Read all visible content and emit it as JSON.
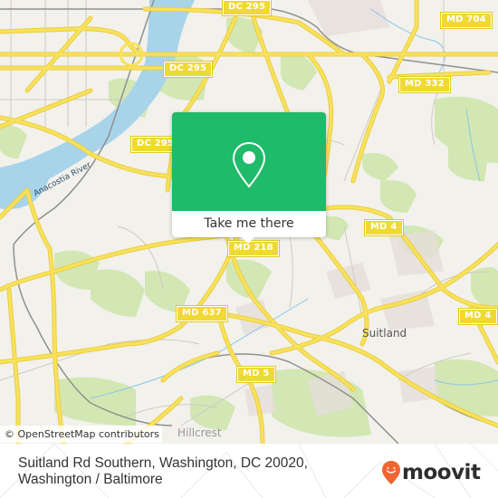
{
  "map": {
    "colors": {
      "background": "#f2f1ec",
      "road": "#f5df4d",
      "road_outline": "#e9c93b",
      "water": "#a8d4ea",
      "park": "#c9e3a6",
      "rail": "#8c8c8c",
      "minor_road": "#c4c0bb"
    },
    "shields": [
      {
        "label": "DC 295",
        "name": "shield-dc-295-top"
      },
      {
        "label": "DC 295",
        "name": "shield-dc-295-mid"
      },
      {
        "label": "DC 295",
        "name": "shield-dc-295-left"
      },
      {
        "label": "MD 704",
        "name": "shield-md-704"
      },
      {
        "label": "MD 332",
        "name": "shield-md-332"
      },
      {
        "label": "MD 4",
        "name": "shield-md-4-center"
      },
      {
        "label": "MD 4",
        "name": "shield-md-4-right"
      },
      {
        "label": "MD 218",
        "name": "shield-md-218"
      },
      {
        "label": "MD 637",
        "name": "shield-md-637"
      },
      {
        "label": "MD 5",
        "name": "shield-md-5"
      }
    ],
    "places": [
      {
        "label": "Suitland"
      },
      {
        "label": "Anacostia River"
      },
      {
        "label": "Hillcrest"
      }
    ],
    "popup": {
      "pin_icon": "map-pin-icon",
      "button_label": "Take me there",
      "accent": "#1fba6a"
    },
    "attribution": "© OpenStreetMap contributors"
  },
  "footer": {
    "address_line1": "Suitland Rd Southern, Washington, DC 20020,",
    "address_line2": "Washington / Baltimore",
    "logo": {
      "icon": "moovit-smile-pin-icon",
      "wordmark": "moovit",
      "brand_color": "#f26531"
    }
  }
}
